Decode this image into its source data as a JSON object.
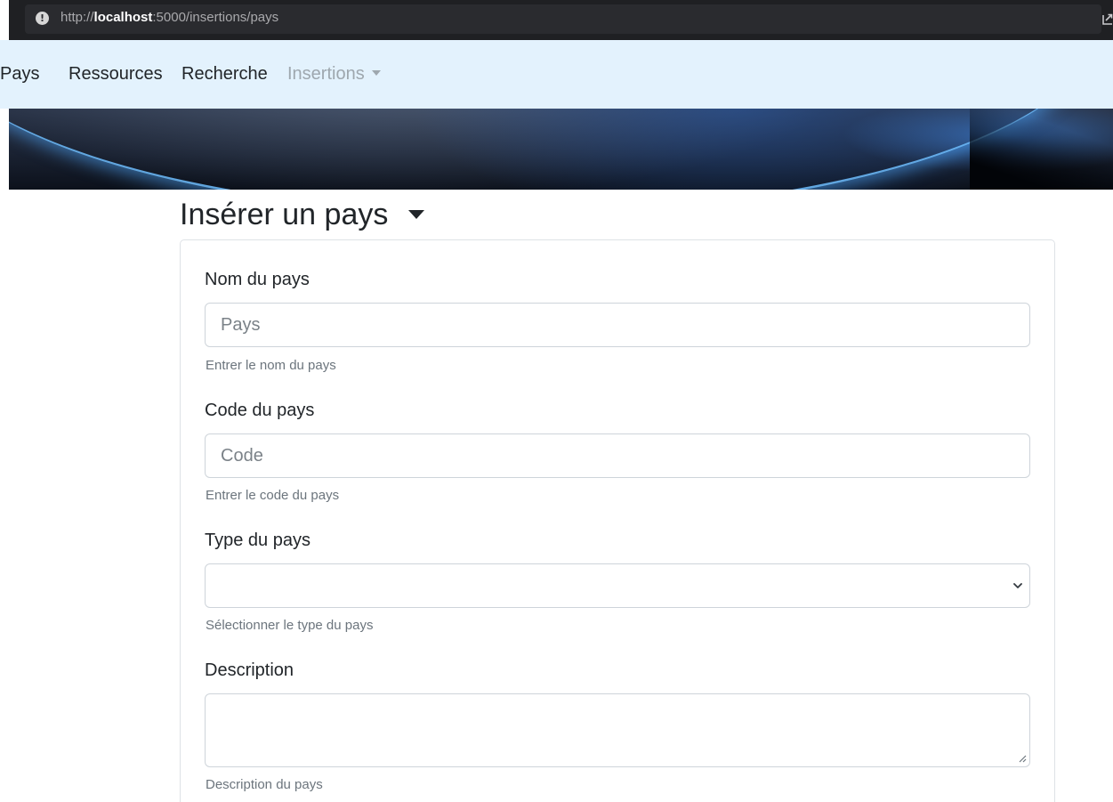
{
  "browser": {
    "url_prefix": "http://",
    "url_host": "localhost",
    "url_rest": ":5000/insertions/pays",
    "info_icon": "info-icon",
    "share_icon": "share-icon"
  },
  "navbar": {
    "items": [
      {
        "label": "Pays"
      },
      {
        "label": "Ressources"
      },
      {
        "label": "Recherche"
      },
      {
        "label": "Insertions",
        "dropdown": true
      }
    ],
    "background": "#e3f2fd"
  },
  "page": {
    "title": "Insérer un pays"
  },
  "form": {
    "name": {
      "label": "Nom du pays",
      "placeholder": "Pays",
      "help": "Entrer le nom du pays"
    },
    "code": {
      "label": "Code du pays",
      "placeholder": "Code",
      "help": "Entrer le code du pays"
    },
    "type": {
      "label": "Type du pays",
      "value": "",
      "help": "Sélectionner le type du pays"
    },
    "description": {
      "label": "Description",
      "value": "",
      "help": "Description du pays"
    }
  }
}
